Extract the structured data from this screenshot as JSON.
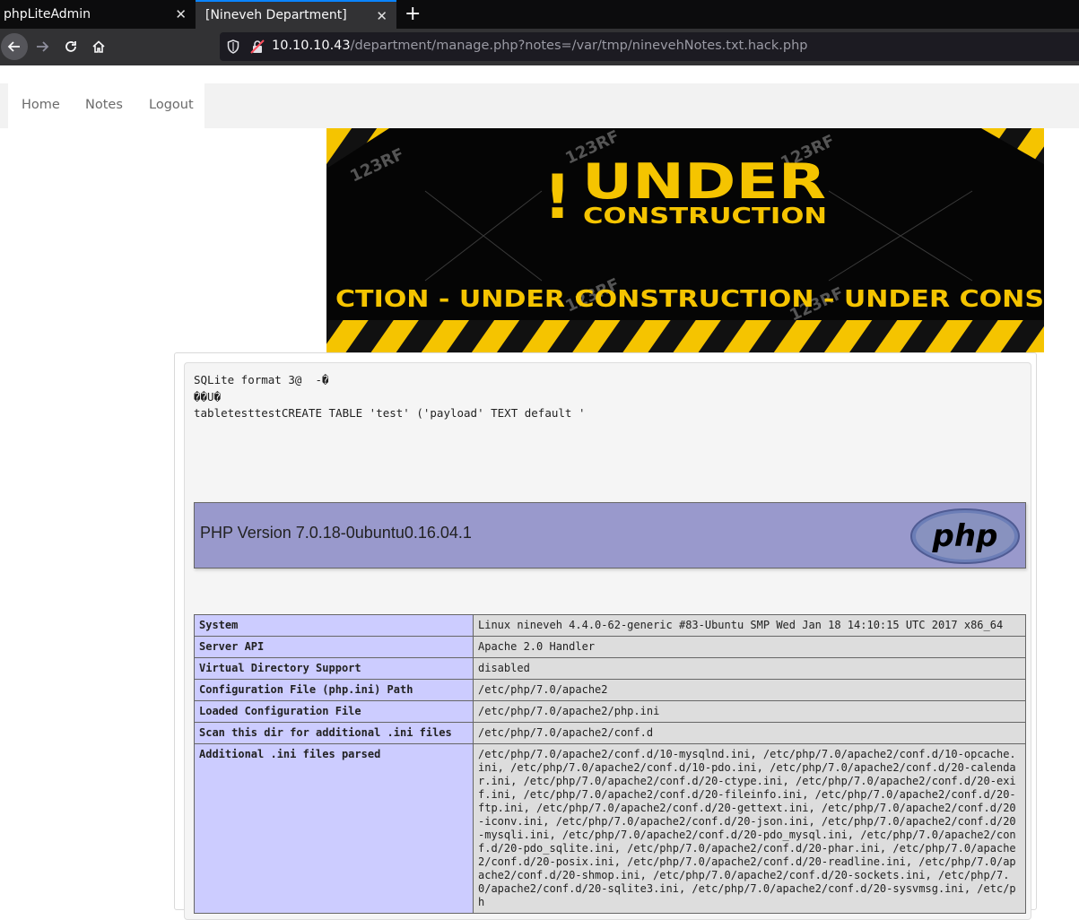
{
  "browser": {
    "tabs": [
      {
        "title": "phpLiteAdmin",
        "active": false
      },
      {
        "title": "[Nineveh Department]",
        "active": true
      }
    ],
    "url_host": "10.10.10.43",
    "url_path": "/department/manage.php?notes=/var/tmp/ninevehNotes.txt.hack.php"
  },
  "page_nav": {
    "links": [
      "Home",
      "Notes",
      "Logout"
    ]
  },
  "banner": {
    "title_mark": "!",
    "title": "UNDER",
    "subtitle": "CONSTRUCTION",
    "strip_text": "CTION - UNDER  CONSTRUCTION - UNDER  CONS",
    "watermark": "123RF"
  },
  "note_output": {
    "lines": [
      "SQLite format 3@  -�",
      "��U�",
      "tabletesttestCREATE TABLE 'test' ('payload' TEXT default '"
    ]
  },
  "phpinfo": {
    "version_title": "PHP Version 7.0.18-0ubuntu0.16.04.1",
    "logo_text": "php",
    "rows": [
      {
        "key": "System",
        "value": "Linux nineveh 4.4.0-62-generic #83-Ubuntu SMP Wed Jan 18 14:10:15 UTC 2017 x86_64"
      },
      {
        "key": "Server API",
        "value": "Apache 2.0 Handler"
      },
      {
        "key": "Virtual Directory Support",
        "value": "disabled"
      },
      {
        "key": "Configuration File (php.ini) Path",
        "value": "/etc/php/7.0/apache2"
      },
      {
        "key": "Loaded Configuration File",
        "value": "/etc/php/7.0/apache2/php.ini"
      },
      {
        "key": "Scan this dir for additional .ini files",
        "value": "/etc/php/7.0/apache2/conf.d"
      },
      {
        "key": "Additional .ini files parsed",
        "value": "/etc/php/7.0/apache2/conf.d/10-mysqlnd.ini, /etc/php/7.0/apache2/conf.d/10-opcache.ini, /etc/php/7.0/apache2/conf.d/10-pdo.ini, /etc/php/7.0/apache2/conf.d/20-calendar.ini, /etc/php/7.0/apache2/conf.d/20-ctype.ini, /etc/php/7.0/apache2/conf.d/20-exif.ini, /etc/php/7.0/apache2/conf.d/20-fileinfo.ini, /etc/php/7.0/apache2/conf.d/20-ftp.ini, /etc/php/7.0/apache2/conf.d/20-gettext.ini, /etc/php/7.0/apache2/conf.d/20-iconv.ini, /etc/php/7.0/apache2/conf.d/20-json.ini, /etc/php/7.0/apache2/conf.d/20-mysqli.ini, /etc/php/7.0/apache2/conf.d/20-pdo_mysql.ini, /etc/php/7.0/apache2/conf.d/20-pdo_sqlite.ini, /etc/php/7.0/apache2/conf.d/20-phar.ini, /etc/php/7.0/apache2/conf.d/20-posix.ini, /etc/php/7.0/apache2/conf.d/20-readline.ini, /etc/php/7.0/apache2/conf.d/20-shmop.ini, /etc/php/7.0/apache2/conf.d/20-sockets.ini, /etc/php/7.0/apache2/conf.d/20-sqlite3.ini, /etc/php/7.0/apache2/conf.d/20-sysvmsg.ini, /etc/ph"
      }
    ]
  }
}
